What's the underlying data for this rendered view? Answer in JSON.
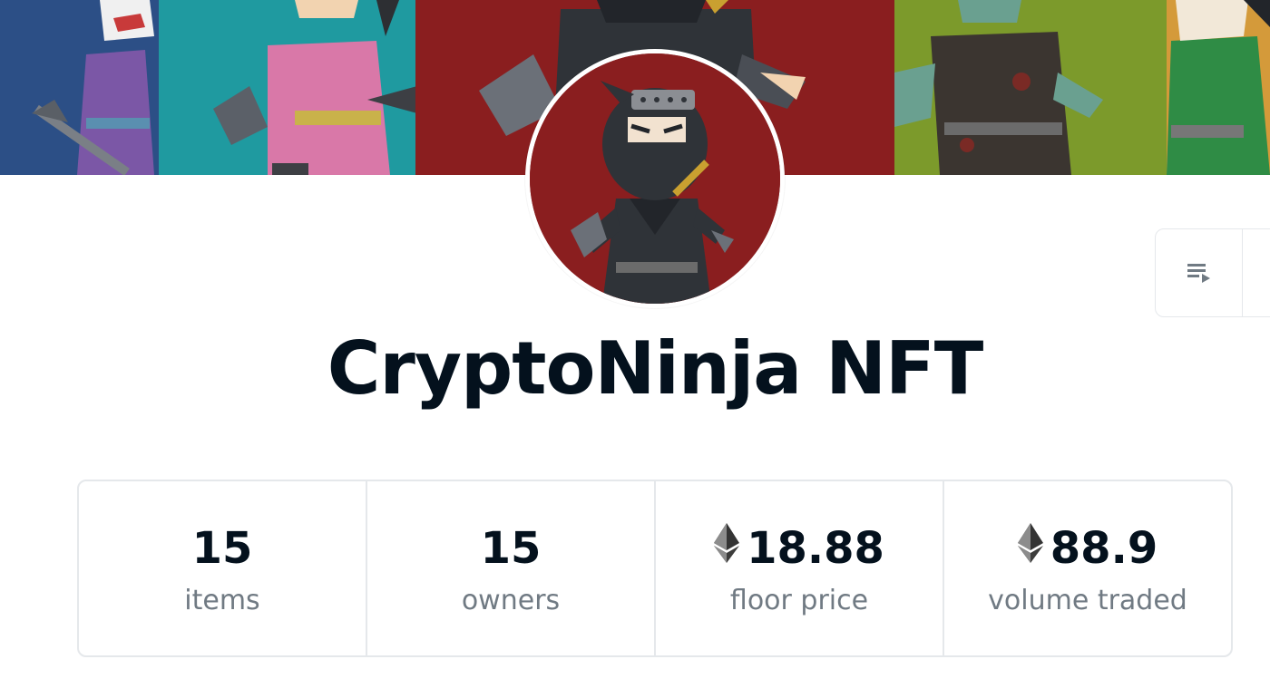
{
  "collection": {
    "name": "CryptoNinja NFT"
  },
  "banner": {
    "panels": [
      {
        "color": "#2c4f86",
        "outfit": "#7b57a6"
      },
      {
        "color": "#1f9aa0",
        "outfit": "#d978a8"
      },
      {
        "color": "#8a1e1f",
        "outfit": "#2f3338"
      },
      {
        "color": "#7c9a2b",
        "outfit": "#3b3530"
      },
      {
        "color": "#d49a3a",
        "outfit": "#2f8c45"
      }
    ]
  },
  "toolbar": {
    "queue_icon": "playlist-icon"
  },
  "stats": [
    {
      "value": "15",
      "label": "items",
      "eth": false
    },
    {
      "value": "15",
      "label": "owners",
      "eth": false
    },
    {
      "value": "18.88",
      "label": "floor price",
      "eth": true
    },
    {
      "value": "88.9",
      "label": "volume traded",
      "eth": true
    }
  ],
  "colors": {
    "text_primary": "#04111d",
    "text_secondary": "#707a83",
    "border": "#e5e8eb",
    "avatar_bg": "#8a1e1f"
  }
}
